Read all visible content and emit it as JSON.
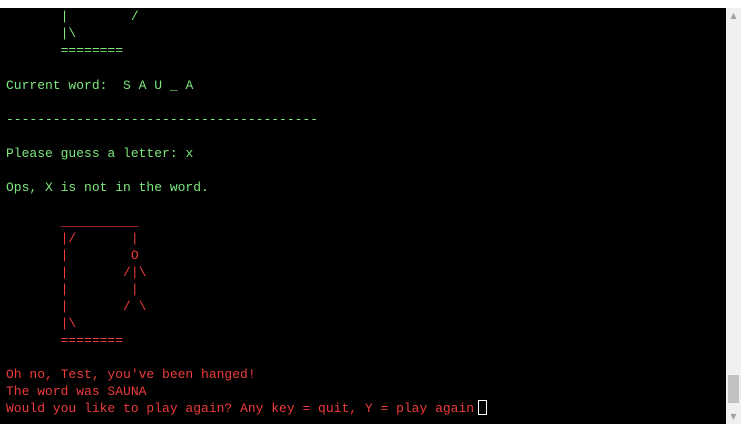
{
  "terminal": {
    "top_gallows": [
      "       |        /",
      "       |\\",
      "       ========"
    ],
    "current_word_label": "Current word:  ",
    "current_word": "S A U _ A",
    "divider": "----------------------------------------",
    "prompt": "Please guess a letter: ",
    "guess": "x",
    "feedback": "Ops, X is not in the word.",
    "bottom_gallows": [
      "       __________",
      "       |/       |",
      "       |        O",
      "       |       /|\\",
      "       |        |",
      "       |       / \\",
      "       |\\",
      "       ========"
    ],
    "lose_message": "Oh no, Test, you've been hanged!",
    "reveal_message": "The word was SAUNA",
    "play_again_prompt": "Would you like to play again? Any key = quit, Y = play again"
  },
  "scrollbar": {
    "up_icon": "▲",
    "down_icon": "▼"
  },
  "colors": {
    "green": "#7de77d",
    "red": "#ee3b3b",
    "background": "#000000"
  }
}
